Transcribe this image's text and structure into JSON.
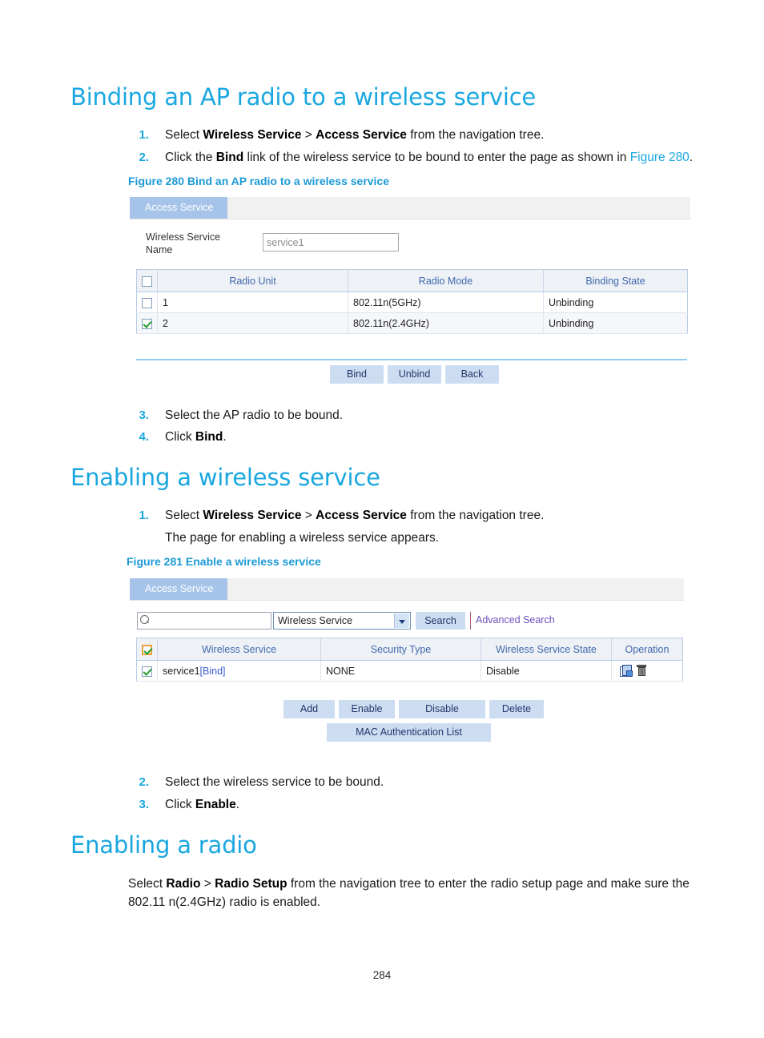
{
  "document": {
    "page_number": "284",
    "accent_color": "#1aa7e0",
    "caption_color": "#1c9ad6"
  },
  "sections": [
    {
      "id": "binding",
      "title": "Binding an AP radio to a wireless service",
      "steps": [
        {
          "num": "1.",
          "text_prefix": "Select ",
          "bold1": "Wireless Service",
          "mid": " > ",
          "bold2": "Access Service",
          "text_suffix": " from the navigation tree."
        },
        {
          "num": "2.",
          "text_prefix": "Click the ",
          "bold1": "Bind",
          "mid": " link of the wireless service to be bound to enter the page as shown in ",
          "xref": "Figure 280",
          "text_suffix": "."
        }
      ],
      "steps_after": [
        {
          "num": "3.",
          "text": "Select the AP radio to be bound."
        },
        {
          "num": "4.",
          "text_prefix": "Click ",
          "bold1": "Bind",
          "text_suffix": "."
        }
      ]
    },
    {
      "id": "enabling-service",
      "title": "Enabling a wireless service",
      "steps": [
        {
          "num": "1.",
          "text_prefix": "Select ",
          "bold1": "Wireless Service",
          "mid": " > ",
          "bold2": "Access Service",
          "text_suffix": " from the navigation tree."
        }
      ],
      "note": "The page for enabling a wireless service appears.",
      "steps_after": [
        {
          "num": "2.",
          "text": "Select the wireless service to be bound."
        },
        {
          "num": "3.",
          "text_prefix": "Click ",
          "bold1": "Enable",
          "text_suffix": "."
        }
      ]
    },
    {
      "id": "enabling-radio",
      "title": "Enabling a radio",
      "paragraph": {
        "prefix": "Select ",
        "bold1": "Radio",
        "mid": " > ",
        "bold2": "Radio Setup",
        "suffix": " from the navigation tree to enter the radio setup page and make sure the 802.11 n(2.4GHz) radio is enabled."
      }
    }
  ],
  "figure280": {
    "caption": "Figure 280 Bind an AP radio to a wireless service",
    "tab_label": "Access Service",
    "form": {
      "label_line1": "Wireless Service",
      "label_line2": "Name",
      "input_value": "service1"
    },
    "table": {
      "headers": [
        "",
        "Radio Unit",
        "Radio Mode",
        "Binding State"
      ],
      "header_checkbox_checked": false,
      "rows": [
        {
          "checked": false,
          "radio_unit": "1",
          "radio_mode": "802.11n(5GHz)",
          "binding_state": "Unbinding"
        },
        {
          "checked": true,
          "radio_unit": "2",
          "radio_mode": "802.11n(2.4GHz)",
          "binding_state": "Unbinding"
        }
      ]
    },
    "buttons": [
      "Bind",
      "Unbind",
      "Back"
    ]
  },
  "figure281": {
    "caption": "Figure 281 Enable a wireless service",
    "tab_label": "Access Service",
    "search": {
      "input_value": "",
      "icon": "search-icon",
      "select_value": "Wireless Service",
      "search_button": "Search",
      "advanced_link": "Advanced Search"
    },
    "table": {
      "headers": [
        "",
        "Wireless Service",
        "Security Type",
        "Wireless Service State",
        "Operation"
      ],
      "header_checkbox_checked": true,
      "rows": [
        {
          "checked": true,
          "wireless_service": "service1",
          "wireless_service_link": "[Bind]",
          "security_type": "NONE",
          "state": "Disable",
          "operation_icons": [
            "copy-icon",
            "delete-icon"
          ]
        }
      ]
    },
    "buttons_row1": [
      "Add",
      "Enable",
      "Disable",
      "Delete"
    ],
    "buttons_row2": [
      "MAC Authentication List"
    ]
  }
}
